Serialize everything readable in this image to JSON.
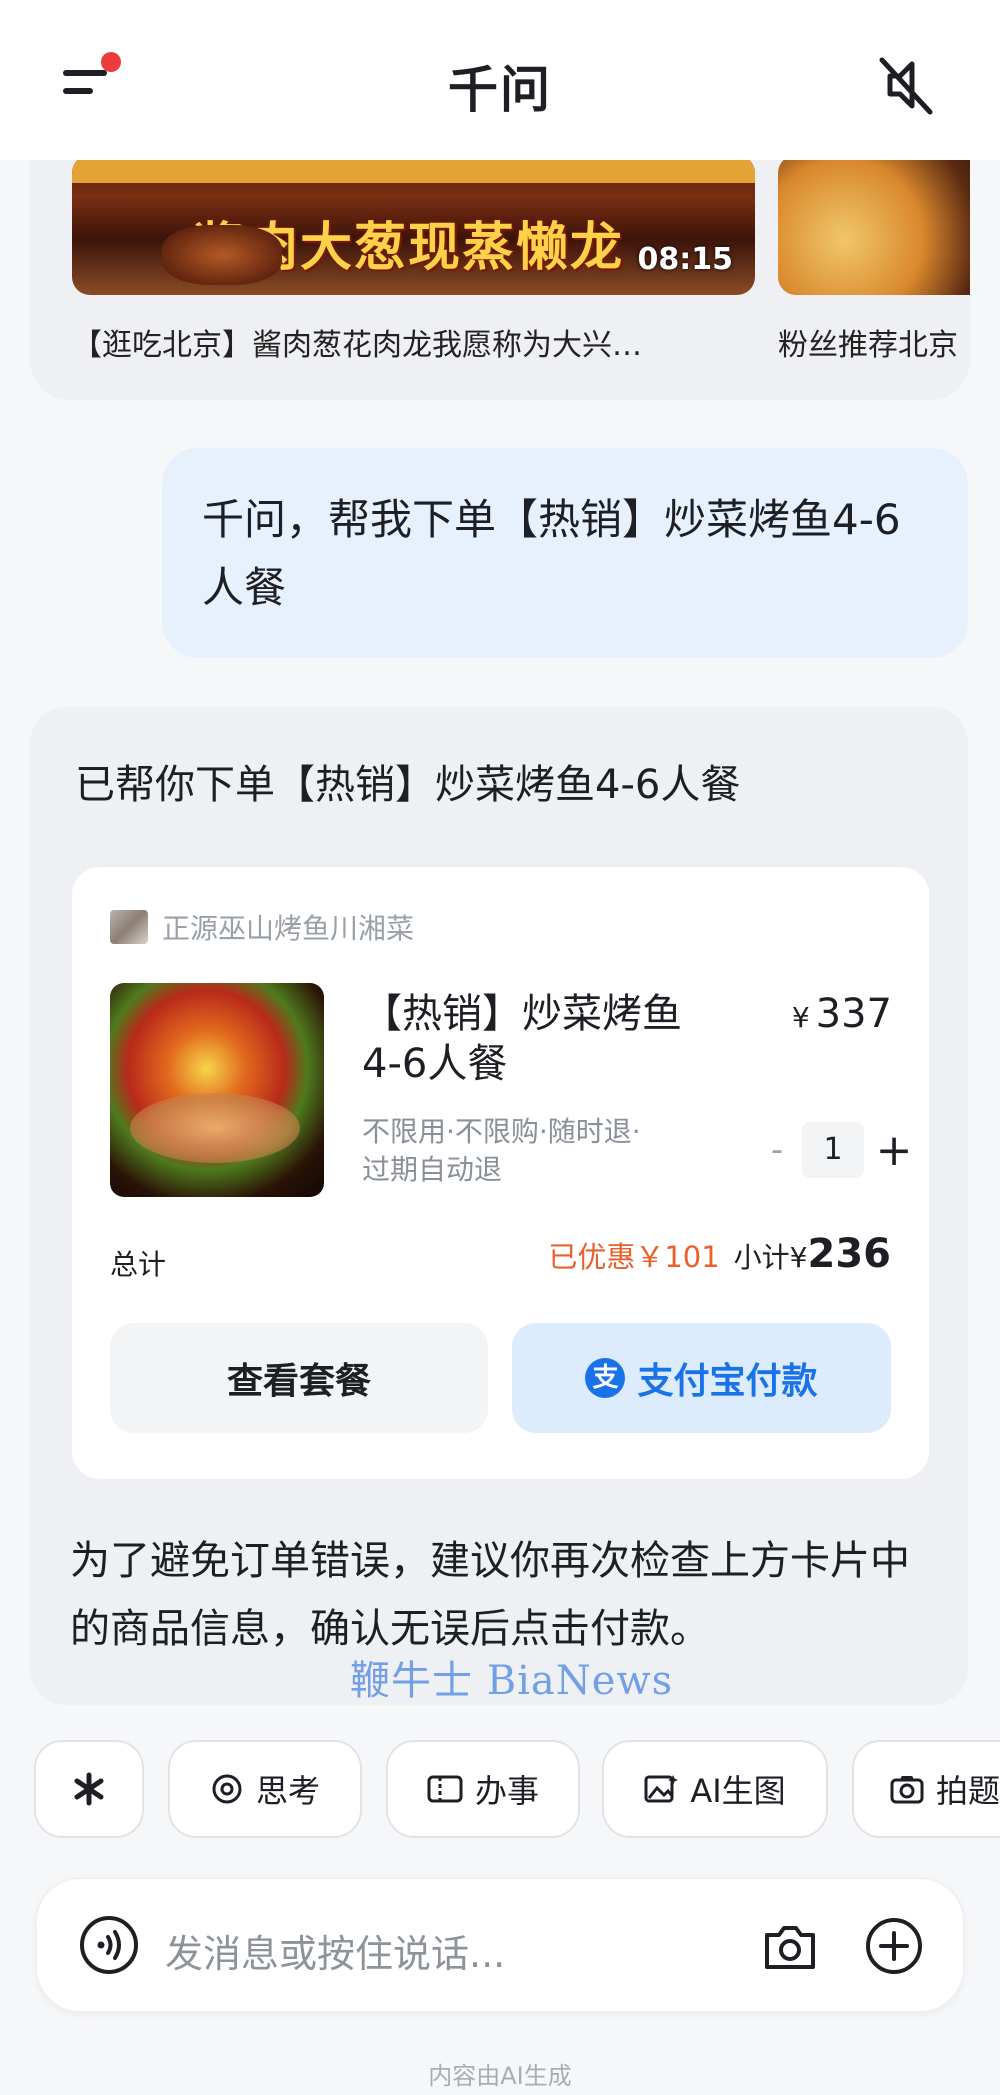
{
  "header": {
    "title": "千问",
    "menu_icon": "menu-icon",
    "notification_dot_color": "#ee3b3b",
    "mute_icon": "speaker-muted-icon"
  },
  "video_card": {
    "main_thumbnail_headline": "酱肉大葱现蒸懒龙",
    "main_duration": "08:15",
    "main_caption": "【逛吃北京】酱肉葱花肉龙我愿称为大兴…",
    "side_caption": "粉丝推荐北京"
  },
  "user_message": {
    "text": "千问，帮我下单【热销】炒菜烤鱼4-6人餐"
  },
  "assistant": {
    "heading": "已帮你下单【热销】炒菜烤鱼4-6人餐",
    "order": {
      "store_name": "正源巫山烤鱼川湘菜",
      "dish_name": "【热销】炒菜烤鱼4-6人餐",
      "price_symbol": "¥",
      "price": "337",
      "terms": "不限用·不限购·随时退·过期自动退",
      "qty_minus": "-",
      "quantity": "1",
      "qty_plus": "+",
      "total_label": "总计",
      "discount": "已优惠￥101",
      "subtotal_label": "小计¥",
      "subtotal": "236",
      "view_button": "查看套餐",
      "pay_button": "支付宝付款",
      "pay_icon_glyph": "支"
    },
    "note": "为了避免订单错误，建议你再次检查上方卡片中的商品信息，确认无误后点击付款。"
  },
  "watermark": "鞭牛士 BiaNews",
  "chips": [
    {
      "label": "",
      "icon": "spark-icon"
    },
    {
      "label": "思考",
      "icon": "think-icon"
    },
    {
      "label": "办事",
      "icon": "ticket-icon"
    },
    {
      "label": "AI生图",
      "icon": "image-gen-icon"
    },
    {
      "label": "拍题",
      "icon": "photo-question-icon"
    }
  ],
  "input": {
    "placeholder": "发消息或按住说话...",
    "voice_icon": "voice-icon",
    "camera_icon": "camera-icon",
    "plus_icon": "plus-circle-icon"
  },
  "footer_notice": "内容由AI生成",
  "colors": {
    "accent_blue": "#1a72e8",
    "discount_orange": "#e8612c",
    "user_bubble": "#e6f1fd"
  }
}
